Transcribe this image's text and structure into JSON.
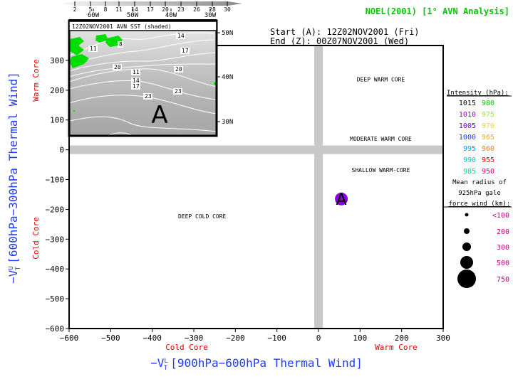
{
  "chart_data": {
    "type": "scatter",
    "title": "NOEL(2001) [1° AVN Analysis]",
    "start_label": "Start (A): 12Z02NOV2001 (Fri)",
    "end_label": "End (Z): 00Z07NOV2001 (Wed)",
    "xlabel": "-Vᵀᴸ [900hPa-600hPa Thermal Wind]",
    "xlabel_prefix": "−V",
    "xlabel_sub": "T",
    "xlabel_sup": "L",
    "xlabel_text": "[900hPa−600hPa Thermal Wind]",
    "ylabel": "-Vᵀᵁ [600hPa-300hPa Thermal Wind]",
    "ylabel_prefix": "−V",
    "ylabel_sub": "T",
    "ylabel_sup": "U",
    "ylabel_text": "[600hPa−300hPa Thermal Wind]",
    "x_cold_label": "Cold Core",
    "x_warm_label": "Warm Core",
    "y_cold_label": "Cold Core",
    "y_warm_label": "Warm Core",
    "xlim": [
      -600,
      300
    ],
    "ylim": [
      -600,
      350
    ],
    "xticks": [
      -600,
      -500,
      -400,
      -300,
      -200,
      -100,
      0,
      100,
      200,
      300
    ],
    "yticks": [
      -600,
      -500,
      -400,
      -300,
      -200,
      -100,
      0,
      100,
      200,
      300
    ],
    "grid": false,
    "region_labels": [
      {
        "text": "DEEP WARM CORE",
        "x": 150,
        "y": 230
      },
      {
        "text": "MODERATE WARM CORE",
        "x": 150,
        "y": 30
      },
      {
        "text": "SHALLOW WARM-CORE",
        "x": 150,
        "y": -75
      },
      {
        "text": "DEEP COLD CORE",
        "x": -280,
        "y": -230
      }
    ],
    "points": [
      {
        "label": "A",
        "x": 55,
        "y": -165,
        "intensity_hPa": 1010,
        "color": "#8a00e0",
        "gale_radius_km": "<100"
      }
    ],
    "legend": {
      "placement": "right",
      "intensity_title": "Intensity (hPa):",
      "intensity": [
        {
          "value": "1015",
          "color": "#000000"
        },
        {
          "value": "980",
          "color": "#00d000"
        },
        {
          "value": "1010",
          "color": "#a000c8"
        },
        {
          "value": "975",
          "color": "#a0e632"
        },
        {
          "value": "1005",
          "color": "#6e00dc"
        },
        {
          "value": "970",
          "color": "#e6dc32"
        },
        {
          "value": "1000",
          "color": "#1e3cff"
        },
        {
          "value": "965",
          "color": "#e6af2d"
        },
        {
          "value": "995",
          "color": "#00a0ff"
        },
        {
          "value": "960",
          "color": "#f08228"
        },
        {
          "value": "990",
          "color": "#00c8c8"
        },
        {
          "value": "955",
          "color": "#fa0000"
        },
        {
          "value": "985",
          "color": "#00dc8c"
        },
        {
          "value": "950",
          "color": "#e6007d"
        }
      ],
      "radius_title_lines": [
        "Mean radius of",
        "925hPa gale",
        "force wind (km):"
      ],
      "radius": [
        "<100",
        "200",
        "300",
        "500",
        "750"
      ],
      "radius_color": "#c8007a"
    },
    "inset": {
      "title": "12Z02NOV2001 AVN SST (shaded)",
      "lon_labels": [
        "60W",
        "50W",
        "40W",
        "30W"
      ],
      "lat_labels": [
        "50N",
        "40N",
        "30N"
      ],
      "contour_labels": [
        "14",
        "17",
        "11",
        "14",
        "17",
        "20",
        "20",
        "23",
        "23",
        "11",
        "8"
      ],
      "marker": "A",
      "colorbar_ticks": [
        "2",
        "5",
        "8",
        "11",
        "14",
        "17",
        "20",
        "23",
        "26",
        "28",
        "30"
      ]
    }
  }
}
